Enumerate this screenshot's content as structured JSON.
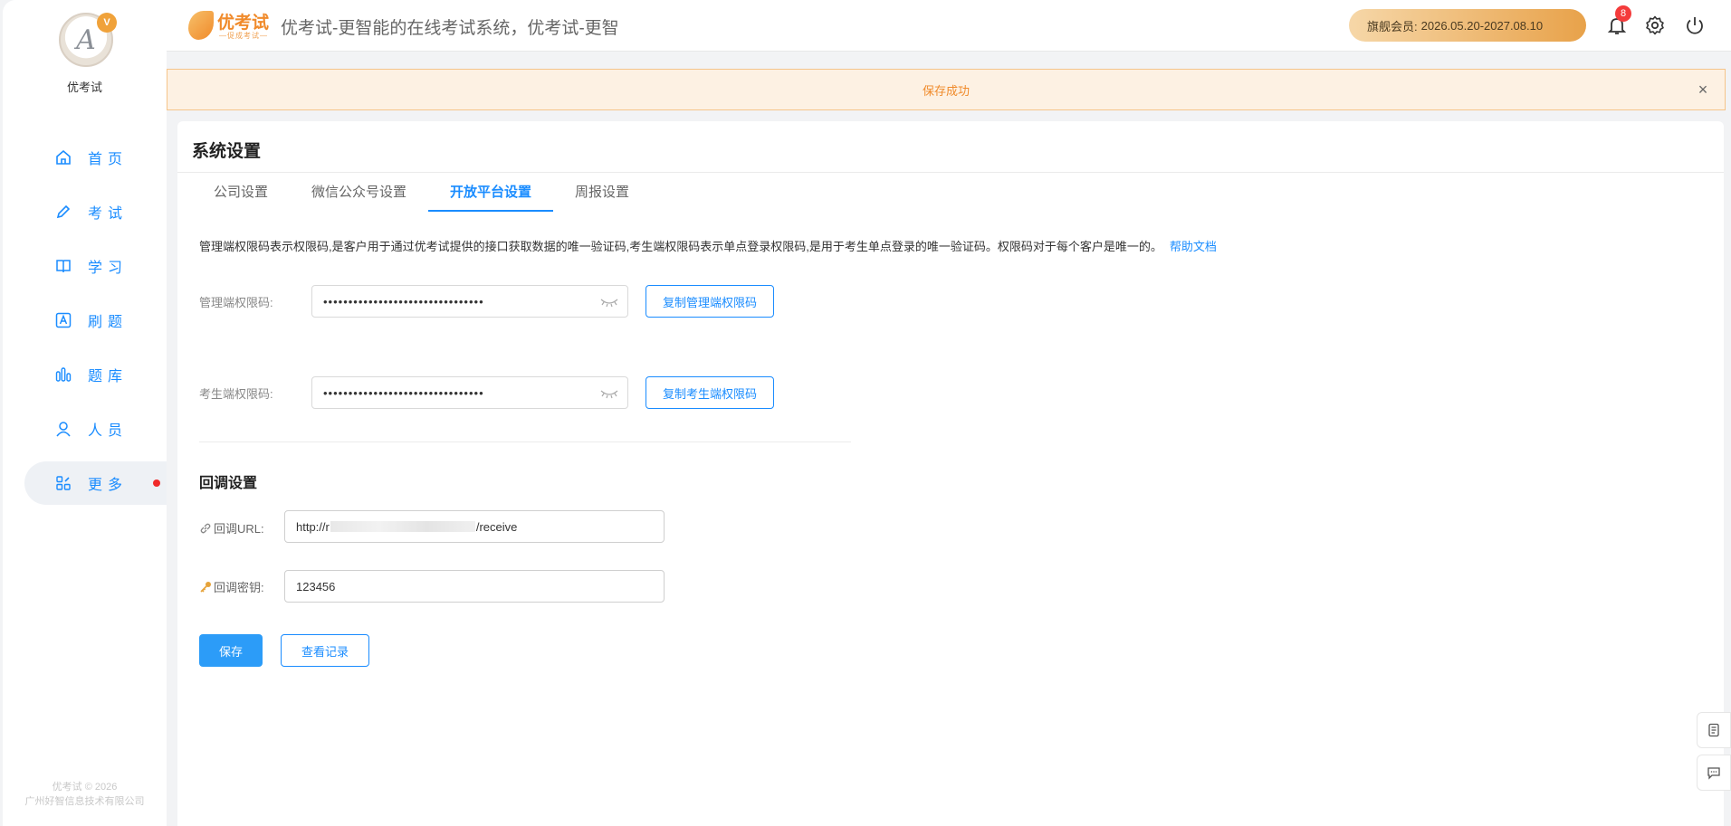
{
  "sidebar": {
    "user_name": "优考试",
    "items": [
      {
        "label": "首页",
        "icon": "home-icon"
      },
      {
        "label": "考试",
        "icon": "pen-icon"
      },
      {
        "label": "学习",
        "icon": "book-icon"
      },
      {
        "label": "刷题",
        "icon": "letter-a-icon"
      },
      {
        "label": "题库",
        "icon": "bars-icon"
      },
      {
        "label": "人员",
        "icon": "person-icon"
      },
      {
        "label": "更多",
        "icon": "grid-icon"
      }
    ],
    "footer_line1": "优考试 © 2026",
    "footer_line2": "广州好智信息技术有限公司"
  },
  "header": {
    "logo_text": "优考试",
    "logo_sub": "—促成考试—",
    "site_title": "优考试-更智能的在线考试系统，优考试-更智",
    "member_label": "旗舰会员:",
    "member_period": "2026.05.20-2027.08.10",
    "notification_count": "8"
  },
  "alert": {
    "message": "保存成功",
    "close": "×"
  },
  "page": {
    "title": "系统设置",
    "tabs": [
      {
        "label": "公司设置",
        "active": false
      },
      {
        "label": "微信公众号设置",
        "active": false
      },
      {
        "label": "开放平台设置",
        "active": true
      },
      {
        "label": "周报设置",
        "active": false
      }
    ],
    "description": "管理端权限码表示权限码,是客户用于通过优考试提供的接口获取数据的唯一验证码,考生端权限码表示单点登录权限码,是用于考生单点登录的唯一验证码。权限码对于每个客户是唯一的。",
    "help_link": "帮助文档",
    "admin_code": {
      "label": "管理端权限码:",
      "value": "••••••••••••••••••••••••••••••••",
      "copy_button": "复制管理端权限码"
    },
    "student_code": {
      "label": "考生端权限码:",
      "value": "••••••••••••••••••••••••••••••••",
      "copy_button": "复制考生端权限码"
    },
    "callback": {
      "section_title": "回调设置",
      "url_label": "回调URL:",
      "url_prefix": "http://r",
      "url_suffix": "/receive",
      "secret_label": "回调密钥:",
      "secret_value": "123456"
    },
    "save_button": "保存",
    "records_button": "查看记录"
  },
  "colors": {
    "accent": "#1a8cff",
    "alert_text": "#f08a2a",
    "alert_bg": "#fdf1e3",
    "badge": "#f43b3b"
  }
}
